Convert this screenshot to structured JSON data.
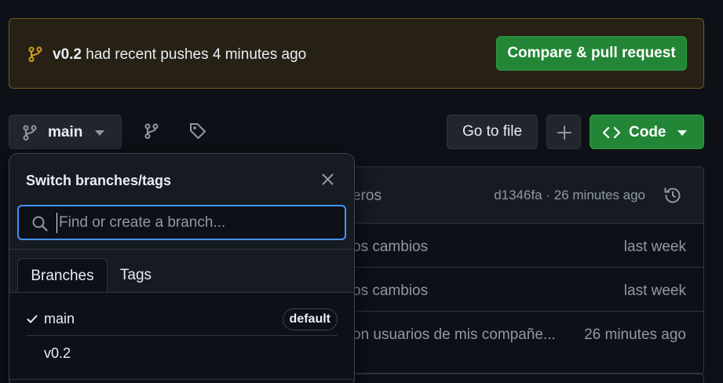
{
  "banner": {
    "branch": "v0.2",
    "message": "had recent pushes 4 minutes ago",
    "compare_label": "Compare & pull request"
  },
  "toolbar": {
    "branch_label": "main",
    "goto_label": "Go to file",
    "code_label": "Code"
  },
  "files": {
    "latest_commit_message_visible": "eros",
    "latest_commit_meta": "d1346fa · 26 minutes ago",
    "rows": [
      {
        "message": "os cambios",
        "time": "last week"
      },
      {
        "message": "os cambios",
        "time": "last week"
      },
      {
        "message": "on usuarios de mis compañe...",
        "time": "26 minutes ago"
      }
    ]
  },
  "dropdown": {
    "title": "Switch branches/tags",
    "search_placeholder": "Find or create a branch...",
    "tabs": [
      "Branches",
      "Tags"
    ],
    "branches": [
      {
        "name": "main",
        "selected": true,
        "badge": "default"
      },
      {
        "name": "v0.2",
        "selected": false,
        "badge": ""
      }
    ]
  },
  "icons": {
    "banner_branch": "git-branch-icon",
    "branch_button": "git-branch-icon",
    "branches_link": "git-branch-icon",
    "tags_link": "tag-icon",
    "plus": "plus-icon",
    "code": "code-icon",
    "close": "close-icon",
    "search": "search-icon",
    "check": "check-icon",
    "history": "history-icon"
  },
  "colors": {
    "accent_green": "#238636",
    "focus_blue": "#4493f8",
    "banner_bg": "#272115",
    "banner_icon": "#d29922"
  }
}
